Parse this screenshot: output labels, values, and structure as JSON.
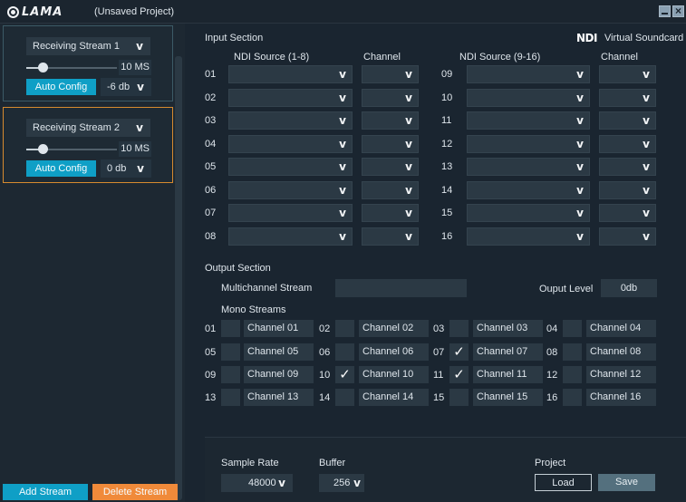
{
  "window": {
    "logo_text": "LAMA",
    "project_title": "(Unsaved Project)",
    "minimize_icon": "minimize-icon",
    "close_icon": "close-icon"
  },
  "streams": [
    {
      "name": "Receiving Stream 1",
      "delay": "10 MS",
      "delay_fraction": 0.18,
      "auto_config": "Auto Config",
      "level": "-6 db",
      "active": false
    },
    {
      "name": "Receiving Stream 2",
      "delay": "10 MS",
      "delay_fraction": 0.18,
      "auto_config": "Auto Config",
      "level": "0 db",
      "active": true
    }
  ],
  "left_buttons": {
    "add": "Add Stream",
    "delete": "Delete Stream"
  },
  "input_section": {
    "title": "Input Section",
    "brand_logo": "NDI",
    "brand_text": "Virtual Soundcard",
    "col_source_1": "NDI Source (1-8)",
    "col_channel_1": "Channel",
    "col_source_2": "NDI Source (9-16)",
    "col_channel_2": "Channel",
    "rows_left": [
      "01",
      "02",
      "03",
      "04",
      "05",
      "06",
      "07",
      "08"
    ],
    "rows_right": [
      "09",
      "10",
      "11",
      "12",
      "13",
      "14",
      "15",
      "16"
    ],
    "chevron": "v"
  },
  "output_section": {
    "title": "Output Section",
    "multichannel_label": "Multichannel  Stream",
    "multichannel_value": "",
    "output_level_label": "Ouput Level",
    "output_level_value": "0db",
    "mono_title": "Mono Streams",
    "channels": [
      {
        "num": "01",
        "label": "Channel 01",
        "checked": false
      },
      {
        "num": "02",
        "label": "Channel 02",
        "checked": false
      },
      {
        "num": "03",
        "label": "Channel 03",
        "checked": false
      },
      {
        "num": "04",
        "label": "Channel 04",
        "checked": false
      },
      {
        "num": "05",
        "label": "Channel 05",
        "checked": false
      },
      {
        "num": "06",
        "label": "Channel 06",
        "checked": false
      },
      {
        "num": "07",
        "label": "Channel 07",
        "checked": true
      },
      {
        "num": "08",
        "label": "Channel 08",
        "checked": false
      },
      {
        "num": "09",
        "label": "Channel 09",
        "checked": false
      },
      {
        "num": "10",
        "label": "Channel 10",
        "checked": true
      },
      {
        "num": "11",
        "label": "Channel 11",
        "checked": true
      },
      {
        "num": "12",
        "label": "Channel 12",
        "checked": false
      },
      {
        "num": "13",
        "label": "Channel 13",
        "checked": false
      },
      {
        "num": "14",
        "label": "Channel 14",
        "checked": false
      },
      {
        "num": "15",
        "label": "Channel 15",
        "checked": false
      },
      {
        "num": "16",
        "label": "Channel 16",
        "checked": false
      }
    ],
    "check_glyph": "✓"
  },
  "footer": {
    "sample_rate_label": "Sample Rate",
    "sample_rate_value": "48000",
    "buffer_label": "Buffer",
    "buffer_value": "256",
    "project_label": "Project",
    "load": "Load",
    "save": "Save"
  },
  "colors": {
    "accent": "#0f9fc6",
    "delete": "#f08a3a",
    "active_border": "#d68a2e",
    "background": "#1a2530",
    "field": "#2b3944"
  }
}
